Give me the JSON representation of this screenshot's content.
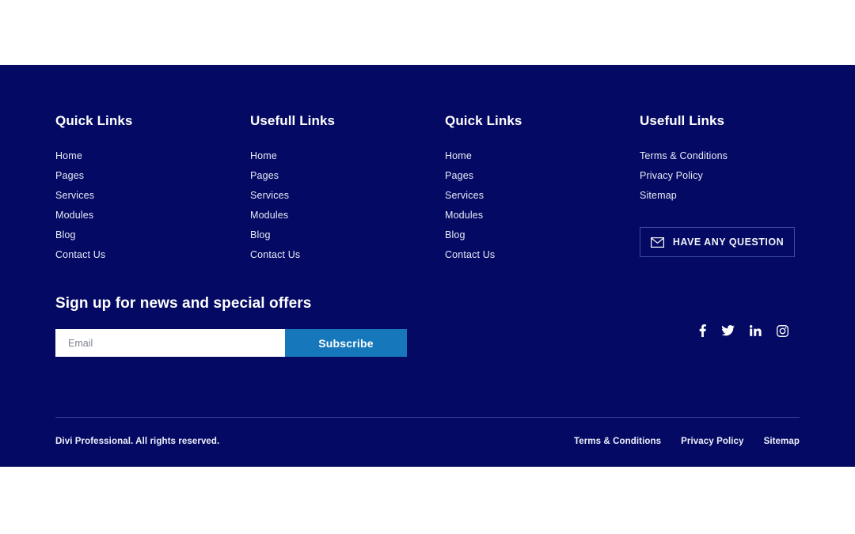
{
  "theme": {
    "footer_bg": "#040a63",
    "page_bg": "#ffffff",
    "accent": "#1678bb",
    "text": "#ffffff",
    "link": "#e8eaf6",
    "divider": "#4a55a3",
    "cta_border": "#3d4a9c"
  },
  "footer": {
    "columns": [
      {
        "title": "Quick Links",
        "links": [
          "Home",
          "Pages",
          "Services",
          "Modules",
          "Blog",
          "Contact Us"
        ]
      },
      {
        "title": "Usefull Links",
        "links": [
          "Home",
          "Pages",
          "Services",
          "Modules",
          "Blog",
          "Contact Us"
        ]
      },
      {
        "title": "Quick Links",
        "links": [
          "Home",
          "Pages",
          "Services",
          "Modules",
          "Blog",
          "Contact Us"
        ]
      },
      {
        "title": "Usefull Links",
        "links": [
          "Terms & Conditions",
          "Privacy Policy",
          "Sitemap"
        ]
      }
    ],
    "cta": {
      "label": "HAVE ANY QUESTION",
      "icon": "envelope-icon"
    },
    "signup": {
      "title": "Sign up for news and special offers",
      "email_placeholder": "Email",
      "email_value": "",
      "subscribe_label": "Subscribe"
    },
    "socials": [
      {
        "name": "facebook-icon",
        "label": "Facebook"
      },
      {
        "name": "twitter-icon",
        "label": "Twitter"
      },
      {
        "name": "linkedin-icon",
        "label": "LinkedIn"
      },
      {
        "name": "instagram-icon",
        "label": "Instagram"
      }
    ],
    "bottom": {
      "copyright": "Divi Professional. All rights reserved.",
      "links": [
        "Terms & Conditions",
        "Privacy Policy",
        "Sitemap"
      ]
    }
  }
}
